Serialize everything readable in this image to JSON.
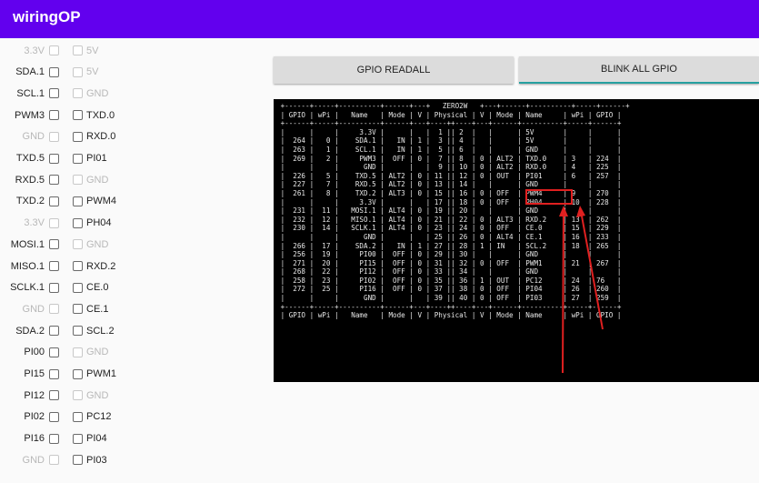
{
  "app": {
    "title": "wiringOP"
  },
  "pins": [
    {
      "left": "3.3V",
      "left_enabled": false,
      "right": "5V",
      "right_enabled": false
    },
    {
      "left": "SDA.1",
      "left_enabled": true,
      "right": "5V",
      "right_enabled": false
    },
    {
      "left": "SCL.1",
      "left_enabled": true,
      "right": "GND",
      "right_enabled": false
    },
    {
      "left": "PWM3",
      "left_enabled": true,
      "right": "TXD.0",
      "right_enabled": true
    },
    {
      "left": "GND",
      "left_enabled": false,
      "right": "RXD.0",
      "right_enabled": true
    },
    {
      "left": "TXD.5",
      "left_enabled": true,
      "right": "PI01",
      "right_enabled": true
    },
    {
      "left": "RXD.5",
      "left_enabled": true,
      "right": "GND",
      "right_enabled": false
    },
    {
      "left": "TXD.2",
      "left_enabled": true,
      "right": "PWM4",
      "right_enabled": true
    },
    {
      "left": "3.3V",
      "left_enabled": false,
      "right": "PH04",
      "right_enabled": true
    },
    {
      "left": "MOSI.1",
      "left_enabled": true,
      "right": "GND",
      "right_enabled": false
    },
    {
      "left": "MISO.1",
      "left_enabled": true,
      "right": "RXD.2",
      "right_enabled": true
    },
    {
      "left": "SCLK.1",
      "left_enabled": true,
      "right": "CE.0",
      "right_enabled": true
    },
    {
      "left": "GND",
      "left_enabled": false,
      "right": "CE.1",
      "right_enabled": true
    },
    {
      "left": "SDA.2",
      "left_enabled": true,
      "right": "SCL.2",
      "right_enabled": true
    },
    {
      "left": "PI00",
      "left_enabled": true,
      "right": "GND",
      "right_enabled": false
    },
    {
      "left": "PI15",
      "left_enabled": true,
      "right": "PWM1",
      "right_enabled": true
    },
    {
      "left": "PI12",
      "left_enabled": true,
      "right": "GND",
      "right_enabled": false
    },
    {
      "left": "PI02",
      "left_enabled": true,
      "right": "PC12",
      "right_enabled": true
    },
    {
      "left": "PI16",
      "left_enabled": true,
      "right": "PI04",
      "right_enabled": true
    },
    {
      "left": "GND",
      "left_enabled": false,
      "right": "PI03",
      "right_enabled": true
    }
  ],
  "buttons": {
    "readall": "GPIO READALL",
    "blink": "BLINK ALL GPIO"
  },
  "terminal": {
    "lines": [
      " +------+-----+----------+------+---+   ZERO2W   +---+------+----------+-----+------+",
      " | GPIO | wPi |   Name   | Mode | V | Physical | V | Mode | Name     | wPi | GPIO |",
      " +------+-----+----------+------+---+----++----+---+------+----------+-----+------+",
      " |      |     |     3.3V |      |   |  1 || 2  |   |      | 5V       |     |      |",
      " |  264 |   0 |    SDA.1 |   IN | 1 |  3 || 4  |   |      | 5V       |     |      |",
      " |  263 |   1 |    SCL.1 |   IN | 1 |  5 || 6  |   |      | GND      |     |      |",
      " |  269 |   2 |     PWM3 |  OFF | 0 |  7 || 8  | 0 | ALT2 | TXD.0    | 3   | 224  |",
      " |      |     |      GND |      |   |  9 || 10 | 0 | ALT2 | RXD.0    | 4   | 225  |",
      " |  226 |   5 |    TXD.5 | ALT2 | 0 | 11 || 12 | 0 | OUT  | PI01     | 6   | 257  |",
      " |  227 |   7 |    RXD.5 | ALT2 | 0 | 13 || 14 |   |      | GND      |     |      |",
      " |  261 |   8 |    TXD.2 | ALT3 | 0 | 15 || 16 | 0 | OFF  | PWM4     | 9   | 270  |",
      " |      |     |     3.3V |      |   | 17 || 18 | 0 | OFF  | PH04     | 10  | 228  |",
      " |  231 |  11 |   MOSI.1 | ALT4 | 0 | 19 || 20 |   |      | GND      |     |      |",
      " |  232 |  12 |   MISO.1 | ALT4 | 0 | 21 || 22 | 0 | ALT3 | RXD.2    | 13  | 262  |",
      " |  230 |  14 |   SCLK.1 | ALT4 | 0 | 23 || 24 | 0 | OFF  | CE.0     | 15  | 229  |",
      " |      |     |      GND |      |   | 25 || 26 | 0 | ALT4 | CE.1     | 16  | 233  |",
      " |  266 |  17 |    SDA.2 |   IN | 1 | 27 || 28 | 1 | IN   | SCL.2    | 18  | 265  |",
      " |  256 |  19 |     PI00 |  OFF | 0 | 29 || 30 |   |      | GND      |     |      |",
      " |  271 |  20 |     PI15 |  OFF | 0 | 31 || 32 | 0 | OFF  | PWM1     | 21  | 267  |",
      " |  268 |  22 |     PI12 |  OFF | 0 | 33 || 34 |   |      | GND      |     |      |",
      " |  258 |  23 |     PI02 |  OFF | 0 | 35 || 36 | 1 | OUT  | PC12     | 24  | 76   |",
      " |  272 |  25 |     PI16 |  OFF | 0 | 37 || 38 | 0 | OFF  | PI04     | 26  | 260  |",
      " |      |     |      GND |      |   | 39 || 40 | 0 | OFF  | PI03     | 27  | 259  |",
      " +------+-----+----------+------+---+----++----+---+------+----------+-----+------+",
      " | GPIO | wPi |   Name   | Mode | V | Physical | V | Mode | Name     | wPi | GPIO |"
    ]
  },
  "annotation_color": "#e02020"
}
